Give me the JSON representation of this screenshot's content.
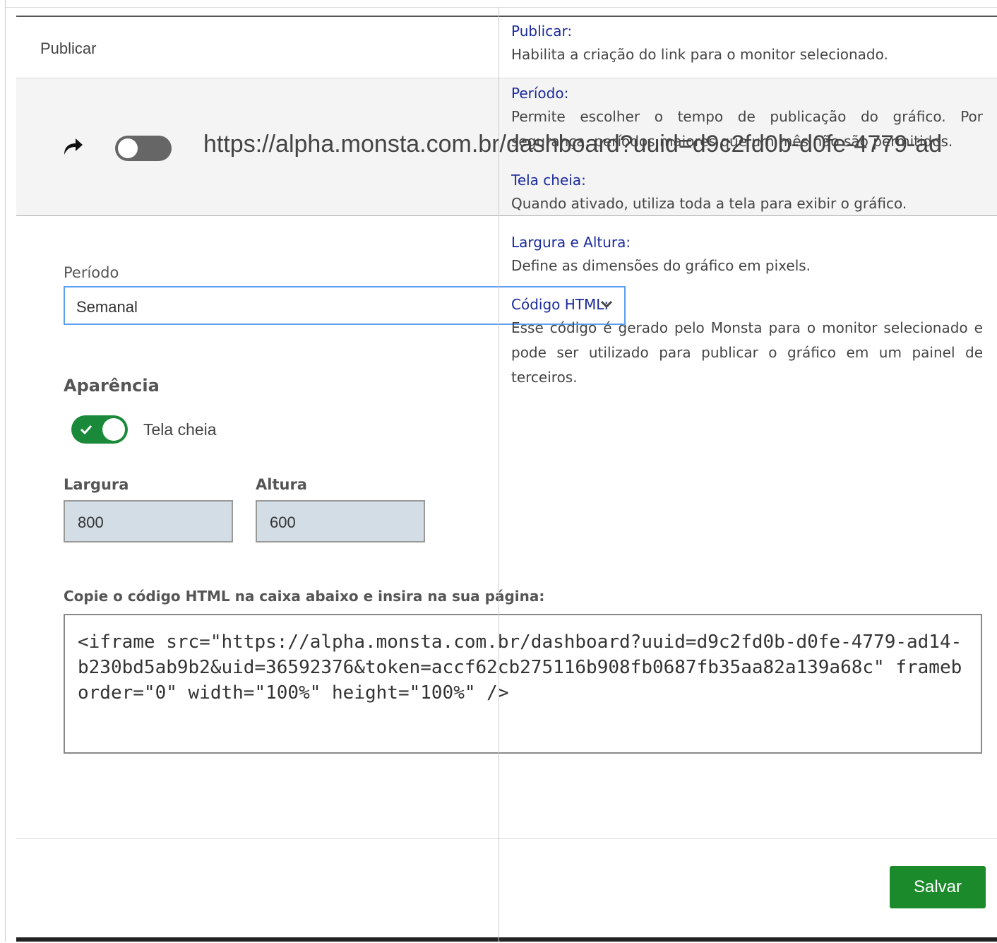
{
  "dialog": {
    "title": "Publicar",
    "publish_url": "https://alpha.monsta.com.br/dashboard?uuid=d9c2fd0b-d0fe-4779-ad",
    "periodo_label": "Período",
    "periodo_value": "Semanal",
    "aparencia_label": "Aparência",
    "fullscreen_label": "Tela cheia",
    "largura_label": "Largura",
    "largura_value": "800",
    "altura_label": "Altura",
    "altura_value": "600",
    "code_label": "Copie o código HTML na caixa abaixo e insira na sua página:",
    "code_value": "<iframe src=\"https://alpha.monsta.com.br/dashboard?uuid=d9c2fd0b-d0fe-4779-ad14-\nb230bd5ab9b2&uid=36592376&token=accf62cb275116b908fb0687fb35aa82a139a68c\" frameborder=\"0\" width=\"100%\" height=\"100%\" />",
    "save_label": "Salvar"
  },
  "help": [
    {
      "title": "Publicar:",
      "desc": "Habilita a criação do link para o monitor selecionado."
    },
    {
      "title": "Período:",
      "desc": "Permite escolher o tempo de publicação do gráfico. Por segurança, períodos maiores que um mês não são permitidos."
    },
    {
      "title": "Tela cheia:",
      "desc": "Quando ativado, utiliza toda a tela para exibir o gráfico."
    },
    {
      "title": "Largura e Altura:",
      "desc": "Define as dimensões do gráfico em pixels."
    },
    {
      "title": "Código HTML:",
      "desc": "Esse código é gerado pelo Monsta para o monitor selecionado e pode ser utilizado para publicar o gráfico em um painel de terceiros."
    }
  ],
  "icons": {
    "share": "share-arrow-icon",
    "chevron": "chevron-down-icon",
    "check": "check-icon"
  },
  "colors": {
    "accent_green": "#1a8a2a",
    "select_border": "#5a9ff0",
    "help_title": "#1a2a9a"
  }
}
